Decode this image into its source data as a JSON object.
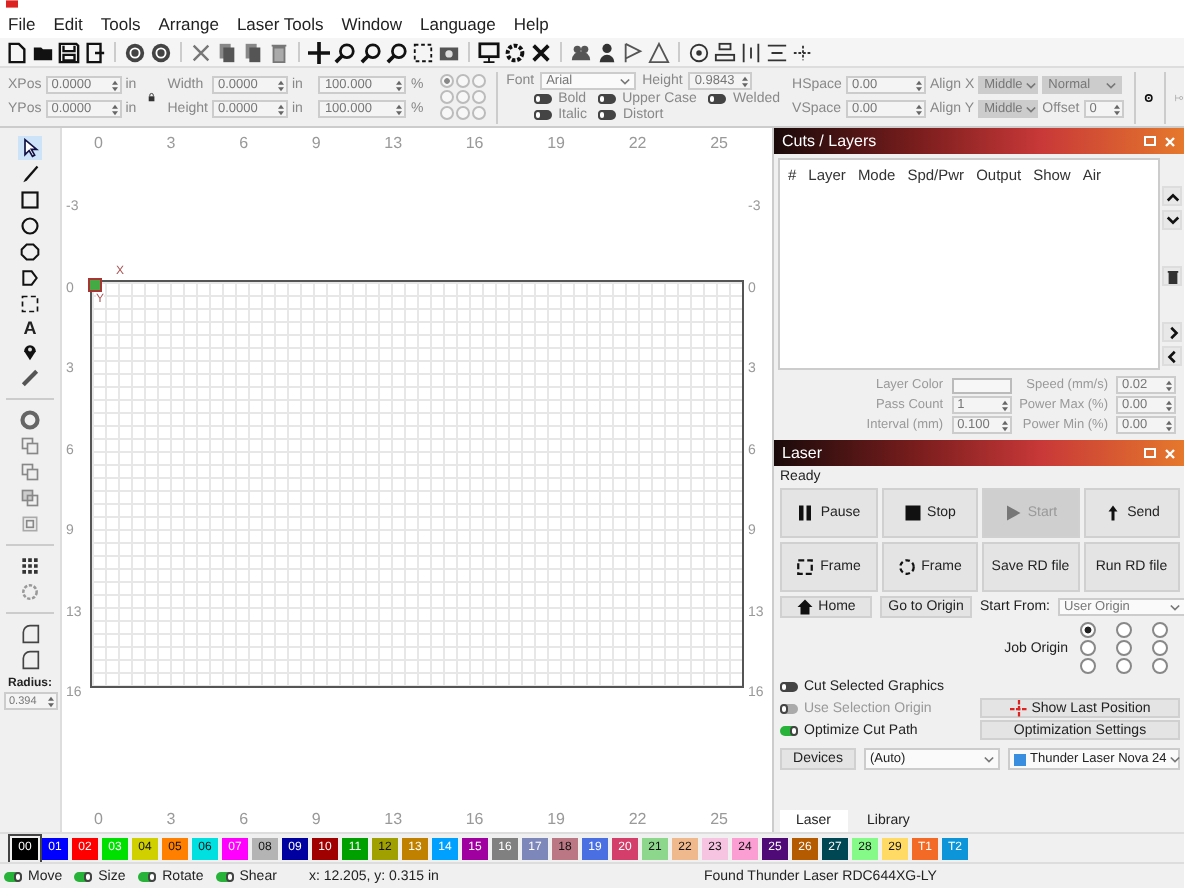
{
  "menu": [
    "File",
    "Edit",
    "Tools",
    "Arrange",
    "Laser Tools",
    "Window",
    "Language",
    "Help"
  ],
  "props": {
    "xpos": {
      "label": "XPos",
      "value": "0.0000",
      "unit": "in"
    },
    "ypos": {
      "label": "YPos",
      "value": "0.0000",
      "unit": "in"
    },
    "width": {
      "label": "Width",
      "value": "0.0000",
      "unit": "in"
    },
    "height": {
      "label": "Height",
      "value": "0.0000",
      "unit": "in"
    },
    "scale_w": {
      "value": "100.000",
      "unit": "%"
    },
    "scale_h": {
      "value": "100.000",
      "unit": "%"
    },
    "anchor": [
      {
        "selected": true
      },
      {
        "selected": false
      },
      {
        "selected": false
      },
      {
        "selected": false
      },
      {
        "selected": false
      },
      {
        "selected": false
      },
      {
        "selected": false
      },
      {
        "selected": false
      },
      {
        "selected": false
      }
    ],
    "font": {
      "label": "Font",
      "value": "Arial"
    },
    "font_height": {
      "label": "Height",
      "value": "0.9843"
    },
    "toggles": [
      {
        "label": "Bold",
        "on": false
      },
      {
        "label": "Upper Case",
        "on": false
      },
      {
        "label": "Welded",
        "on": false
      },
      {
        "label": "Italic",
        "on": false
      },
      {
        "label": "Distort",
        "on": false
      }
    ],
    "hspace": {
      "label": "HSpace",
      "value": "0.00"
    },
    "vspace": {
      "label": "VSpace",
      "value": "0.00"
    },
    "align_x": {
      "label": "Align X",
      "value": "Middle"
    },
    "normal": {
      "value": "Normal"
    },
    "align_y": {
      "label": "Align Y",
      "value": "Middle"
    },
    "offset": {
      "label": "Offset",
      "value": "0"
    }
  },
  "tools": {
    "text_tool": "A",
    "radius_label": "Radius:",
    "radius": "0.394"
  },
  "canvas": {
    "top_ticks": [
      "0",
      "3",
      "6",
      "9",
      "13",
      "16",
      "19",
      "22",
      "25"
    ],
    "left_ticks": [
      "-3",
      "0",
      "3",
      "6",
      "9",
      "13",
      "16"
    ],
    "right_ticks": [
      "-3",
      "0",
      "3",
      "6",
      "9",
      "13",
      "16"
    ],
    "bottom_ticks": [
      "0",
      "3",
      "6",
      "9",
      "13",
      "16",
      "19",
      "22",
      "25"
    ],
    "axis_x": "X",
    "axis_y": "Y"
  },
  "cuts": {
    "title": "Cuts / Layers",
    "columns": [
      "#",
      "Layer",
      "Mode",
      "Spd/Pwr",
      "Output",
      "Show",
      "Air"
    ],
    "fields": [
      {
        "label": "Layer Color"
      },
      {
        "label": "Speed (mm/s)",
        "value": "0.02"
      },
      {
        "label": "Pass Count",
        "value": "1"
      },
      {
        "label": "Power Max (%)",
        "value": "0.00"
      },
      {
        "label": "Interval (mm)",
        "value": "0.100"
      },
      {
        "label": "Power Min (%)",
        "value": "0.00"
      }
    ]
  },
  "laser": {
    "title": "Laser",
    "status": "Ready",
    "buttons": [
      {
        "label": "Pause",
        "kind": "pause",
        "disabled": false
      },
      {
        "label": "Stop",
        "kind": "stop",
        "disabled": false
      },
      {
        "label": "Start",
        "kind": "start",
        "disabled": true
      },
      {
        "label": "Send",
        "kind": "send",
        "disabled": false
      },
      {
        "label": "Frame",
        "kind": "frame",
        "disabled": false
      },
      {
        "label": "Frame",
        "kind": "circle-frame",
        "disabled": false
      },
      {
        "label": "Save RD file",
        "kind": "plain",
        "disabled": false
      },
      {
        "label": "Run RD file",
        "kind": "plain",
        "disabled": false
      }
    ],
    "home": "Home",
    "go_origin": "Go to Origin",
    "start_from_label": "Start From:",
    "start_from": "User Origin",
    "job_origin_label": "Job Origin",
    "job_origin": [
      {
        "selected": true
      },
      {
        "selected": false
      },
      {
        "selected": false
      },
      {
        "selected": false
      },
      {
        "selected": false
      },
      {
        "selected": false
      },
      {
        "selected": false
      },
      {
        "selected": false
      },
      {
        "selected": false
      }
    ],
    "options": [
      {
        "label": "Cut Selected Graphics",
        "on": false,
        "disabled": false
      },
      {
        "label": "Use Selection Origin",
        "on": false,
        "disabled": true
      },
      {
        "label": "Optimize Cut Path",
        "on": true,
        "disabled": false
      }
    ],
    "show_last": "Show Last Position",
    "opt_settings": "Optimization Settings",
    "devices": "Devices",
    "port": "(Auto)",
    "device": "Thunder Laser Nova 24"
  },
  "panel_tabs": [
    {
      "label": "Laser",
      "selected": true
    },
    {
      "label": "Library",
      "selected": false
    }
  ],
  "palette": [
    {
      "label": "00",
      "color": "#000000",
      "selected": true
    },
    {
      "label": "01",
      "color": "#0000ff",
      "selected": false
    },
    {
      "label": "02",
      "color": "#ff0000",
      "selected": false
    },
    {
      "label": "03",
      "color": "#00e000",
      "selected": false
    },
    {
      "label": "04",
      "color": "#d0d000",
      "selected": false
    },
    {
      "label": "05",
      "color": "#ff8000",
      "selected": false
    },
    {
      "label": "06",
      "color": "#00e0e0",
      "selected": false
    },
    {
      "label": "07",
      "color": "#ff00ff",
      "selected": false
    },
    {
      "label": "08",
      "color": "#b4b4b4",
      "selected": false
    },
    {
      "label": "09",
      "color": "#0000a0",
      "selected": false
    },
    {
      "label": "10",
      "color": "#a00000",
      "selected": false
    },
    {
      "label": "11",
      "color": "#00a000",
      "selected": false
    },
    {
      "label": "12",
      "color": "#a0a000",
      "selected": false
    },
    {
      "label": "13",
      "color": "#c08000",
      "selected": false
    },
    {
      "label": "14",
      "color": "#00a0ff",
      "selected": false
    },
    {
      "label": "15",
      "color": "#a000a0",
      "selected": false
    },
    {
      "label": "16",
      "color": "#808080",
      "selected": false
    },
    {
      "label": "17",
      "color": "#7d87b9",
      "selected": false
    },
    {
      "label": "18",
      "color": "#bb7784",
      "selected": false
    },
    {
      "label": "19",
      "color": "#4a6fe3",
      "selected": false
    },
    {
      "label": "20",
      "color": "#d33f6a",
      "selected": false
    },
    {
      "label": "21",
      "color": "#8cd78c",
      "selected": false
    },
    {
      "label": "22",
      "color": "#f0b98d",
      "selected": false
    },
    {
      "label": "23",
      "color": "#f6c4e1",
      "selected": false
    },
    {
      "label": "24",
      "color": "#fa9ed4",
      "selected": false
    },
    {
      "label": "25",
      "color": "#500a78",
      "selected": false
    },
    {
      "label": "26",
      "color": "#b45a00",
      "selected": false
    },
    {
      "label": "27",
      "color": "#004754",
      "selected": false
    },
    {
      "label": "28",
      "color": "#86fa88",
      "selected": false
    },
    {
      "label": "29",
      "color": "#ffdb66",
      "selected": false
    },
    {
      "label": "T1",
      "color": "#f36926",
      "selected": false
    },
    {
      "label": "T2",
      "color": "#0c96d9",
      "selected": false
    }
  ],
  "status_bar": {
    "modes": [
      {
        "label": "Move",
        "on": true
      },
      {
        "label": "Size",
        "on": true
      },
      {
        "label": "Rotate",
        "on": true
      },
      {
        "label": "Shear",
        "on": true
      }
    ],
    "coords": "x: 12.205, y: 0.315 in",
    "message": "Found Thunder Laser RDC644XG-LY"
  }
}
